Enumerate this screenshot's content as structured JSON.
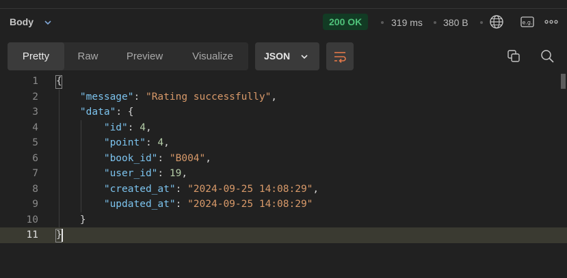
{
  "header": {
    "body_tab": "Body",
    "status": "200 OK",
    "time": "319 ms",
    "size": "380 B",
    "status_color": "#4fc27a",
    "icons": [
      "globe-icon",
      "example-icon",
      "more-icon"
    ]
  },
  "toolbar": {
    "tabs": [
      "Pretty",
      "Raw",
      "Preview",
      "Visualize"
    ],
    "active_tab": "Pretty",
    "format": "JSON",
    "icons": [
      "wrap-lines-icon",
      "copy-icon",
      "search-icon"
    ]
  },
  "editor": {
    "current_line": 11,
    "line_numbers": [
      "1",
      "2",
      "3",
      "4",
      "5",
      "6",
      "7",
      "8",
      "9",
      "10",
      "11"
    ],
    "lines": [
      [
        [
          "p",
          "{"
        ]
      ],
      [
        [
          "p",
          "    "
        ],
        [
          "k",
          "\"message\""
        ],
        [
          "p",
          ": "
        ],
        [
          "s",
          "\"Rating successfully\""
        ],
        [
          "p",
          ","
        ]
      ],
      [
        [
          "p",
          "    "
        ],
        [
          "k",
          "\"data\""
        ],
        [
          "p",
          ": {"
        ]
      ],
      [
        [
          "p",
          "        "
        ],
        [
          "k",
          "\"id\""
        ],
        [
          "p",
          ": "
        ],
        [
          "n",
          "4"
        ],
        [
          "p",
          ","
        ]
      ],
      [
        [
          "p",
          "        "
        ],
        [
          "k",
          "\"point\""
        ],
        [
          "p",
          ": "
        ],
        [
          "n",
          "4"
        ],
        [
          "p",
          ","
        ]
      ],
      [
        [
          "p",
          "        "
        ],
        [
          "k",
          "\"book_id\""
        ],
        [
          "p",
          ": "
        ],
        [
          "s",
          "\"B004\""
        ],
        [
          "p",
          ","
        ]
      ],
      [
        [
          "p",
          "        "
        ],
        [
          "k",
          "\"user_id\""
        ],
        [
          "p",
          ": "
        ],
        [
          "n",
          "19"
        ],
        [
          "p",
          ","
        ]
      ],
      [
        [
          "p",
          "        "
        ],
        [
          "k",
          "\"created_at\""
        ],
        [
          "p",
          ": "
        ],
        [
          "s",
          "\"2024-09-25 14:08:29\""
        ],
        [
          "p",
          ","
        ]
      ],
      [
        [
          "p",
          "        "
        ],
        [
          "k",
          "\"updated_at\""
        ],
        [
          "p",
          ": "
        ],
        [
          "s",
          "\"2024-09-25 14:08:29\""
        ]
      ],
      [
        [
          "p",
          "    }"
        ]
      ],
      [
        [
          "p",
          "}"
        ]
      ]
    ]
  }
}
